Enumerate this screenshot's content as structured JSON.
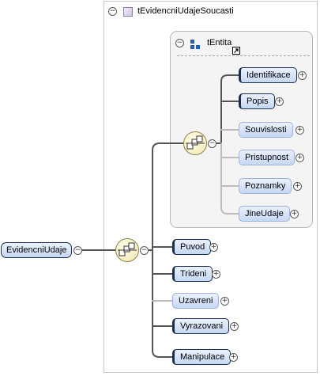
{
  "root_element": {
    "label": "EvidencniUdaje"
  },
  "complex_type": {
    "label": "tEvidencniUdajeSoucasti"
  },
  "inner_type": {
    "label": "tEntita"
  },
  "inner_children": [
    {
      "label": "Identifikace",
      "kind": "required"
    },
    {
      "label": "Popis",
      "kind": "required"
    },
    {
      "label": "Souvislosti",
      "kind": "optional"
    },
    {
      "label": "Pristupnost",
      "kind": "optional"
    },
    {
      "label": "Poznamky",
      "kind": "optional"
    },
    {
      "label": "JineUdaje",
      "kind": "optional"
    }
  ],
  "outer_children": [
    {
      "label": "Puvod",
      "kind": "required"
    },
    {
      "label": "Trideni",
      "kind": "required"
    },
    {
      "label": "Uzavreni",
      "kind": "optional"
    },
    {
      "label": "Vyrazovani",
      "kind": "required"
    },
    {
      "label": "Manipulace",
      "kind": "required"
    }
  ],
  "colors": {
    "node_fill": "#c6d8f3",
    "node_border": "#1d2f4f",
    "optional_border": "#9fb4d5",
    "connector": "#555555",
    "compositor_fill": "#f1e7b3"
  },
  "icons": {
    "collapse": "minus-circle-icon",
    "expand": "plus-circle-icon",
    "sequence": "sequence-compositor-icon",
    "complex_type": "complex-type-icon",
    "inner_type": "entity-type-icon",
    "reference": "reference-arrow-icon"
  },
  "glyphs": {
    "minus": "−",
    "plus": "+"
  }
}
